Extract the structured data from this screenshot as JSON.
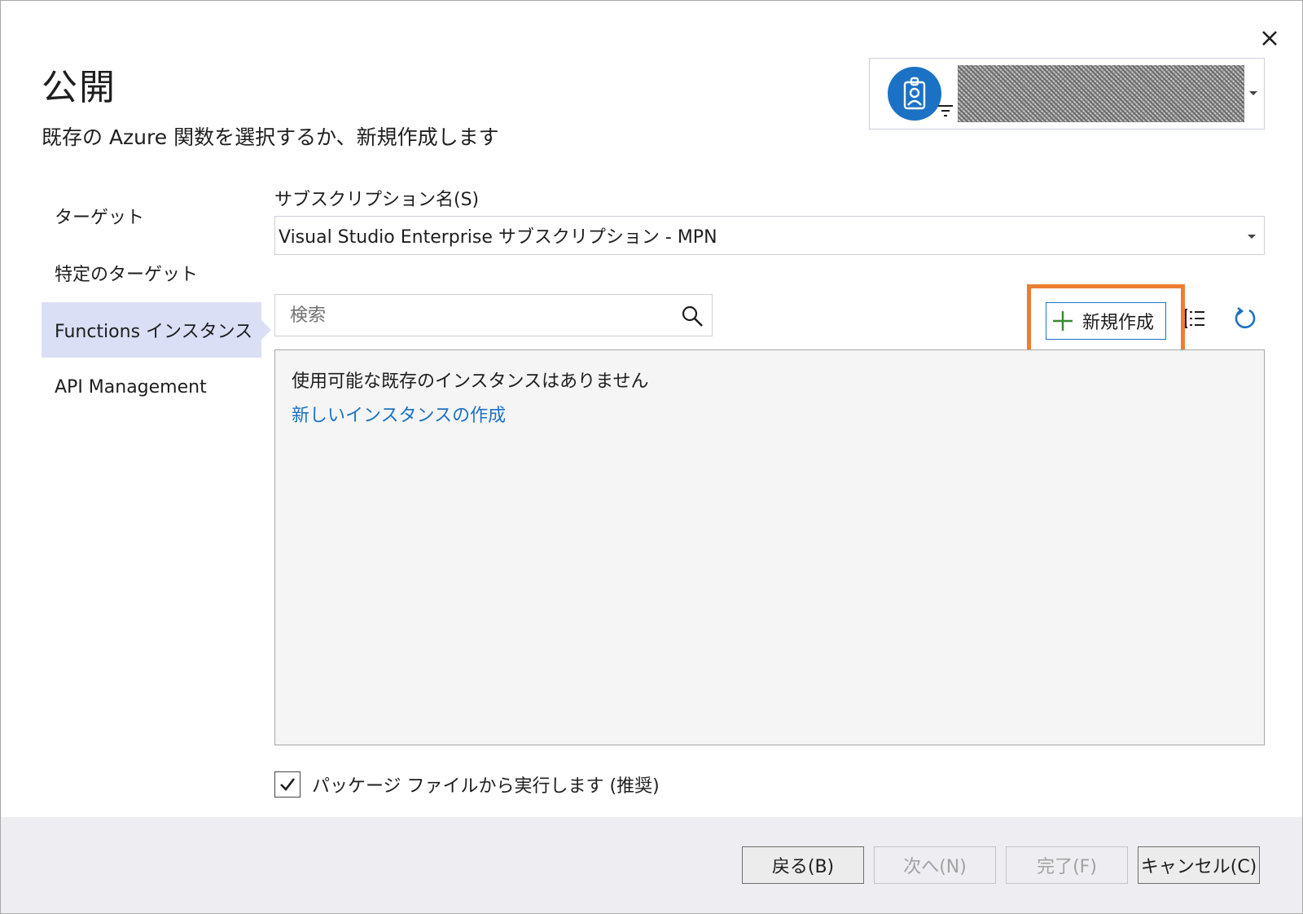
{
  "dialog": {
    "title": "公開",
    "subtitle": "既存の Azure 関数を選択するか、新規作成します"
  },
  "account": {
    "avatar_icon": "badge-person-icon",
    "name_redacted": true
  },
  "nav": {
    "items": [
      {
        "label": "ターゲット",
        "selected": false
      },
      {
        "label": "特定のターゲット",
        "selected": false
      },
      {
        "label": "Functions インスタンス",
        "selected": true
      },
      {
        "label": "API Management",
        "selected": false
      }
    ]
  },
  "subscription": {
    "label": "サブスクリプション名(S)",
    "value": "Visual Studio Enterprise サブスクリプション - MPN"
  },
  "search": {
    "placeholder": "検索"
  },
  "toolbar": {
    "new_label": "新規作成",
    "view_icon": "list-view-icon",
    "refresh_icon": "refresh-icon"
  },
  "list": {
    "empty_text": "使用可能な既存のインスタンスはありません",
    "create_link": "新しいインスタンスの作成"
  },
  "run_from_package": {
    "label": "パッケージ ファイルから実行します (推奨)",
    "checked": true
  },
  "footer": {
    "back": "戻る(B)",
    "next": "次へ(N)",
    "finish": "完了(F)",
    "cancel": "キャンセル(C)"
  },
  "colors": {
    "accent": "#1b72c4",
    "highlight": "#ed7d31",
    "nav_selected": "#dadff6"
  }
}
